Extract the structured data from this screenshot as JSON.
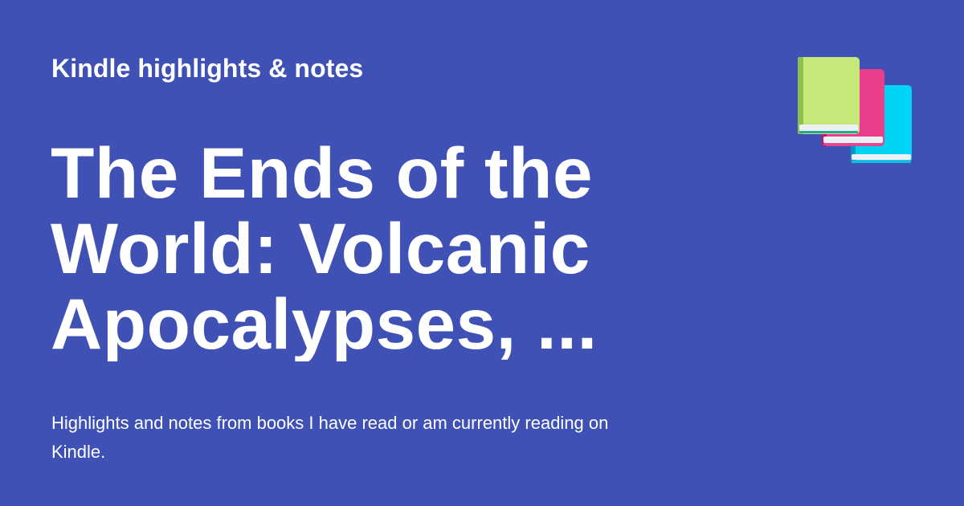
{
  "site": {
    "name": "Kindle highlights & notes"
  },
  "book": {
    "title": "The Ends of the World: Volcanic Apocalypses, ..."
  },
  "page": {
    "description": "Highlights and notes from books I have read or am currently reading on Kindle."
  },
  "icon": {
    "name": "books-icon"
  },
  "colors": {
    "background": "#3f51b5",
    "text": "#ffffff",
    "book_green": "#c5e87b",
    "book_green_spine": "#8bc34a",
    "book_pink": "#e83e8c",
    "book_pink_spine": "#c2185b",
    "book_cyan": "#00d4f5",
    "book_cyan_spine": "#0097c7",
    "page_edge": "#eef1f4",
    "page_line_teal": "#26a69a",
    "page_line_pink": "#e24b93",
    "page_line_cyan": "#1eb8df"
  }
}
